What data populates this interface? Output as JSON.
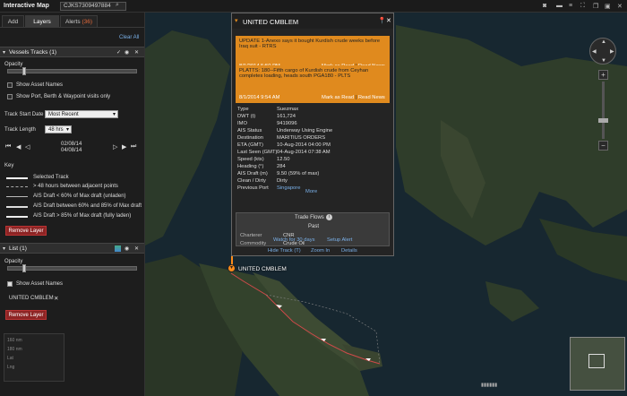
{
  "app": {
    "title": "Interactive Map",
    "search_value": "CJKS7309497884"
  },
  "tabs": [
    {
      "label": "Add"
    },
    {
      "label": "Layers"
    },
    {
      "label": "Alerts"
    }
  ],
  "alerts_count": "(36)",
  "clear_all": "Clear All",
  "vessels": {
    "title": "Vessels Tracks  (1)",
    "opacity_label": "Opacity",
    "opacity": 0.12,
    "show_asset_names": "Show Asset Names",
    "show_port": "Show Port, Berth & Waypoint visits only",
    "track_start_label": "Track Start Date",
    "track_start_value": "Most Recent",
    "track_length_label": "Track Length",
    "track_length_value": "48 hrs",
    "date1": "02/08/14",
    "date2": "04/08/14",
    "key_label": "Key",
    "key_items": [
      "Selected Track",
      "> 48 hours between adjacent points",
      "AIS Draft < 60% of Max draft (unladen)",
      "AIS Draft between 60% and 85% of Max draft",
      "AIS Draft > 85% of Max draft (fully laden)"
    ],
    "remove_label": "Remove Layer"
  },
  "list": {
    "title": "List  (1)",
    "opacity_label": "Opacity",
    "opacity": 0.12,
    "show_asset_names": "Show Asset Names",
    "asset": "UNITED CMBLEM",
    "remove_label": "Remove Layer"
  },
  "popup": {
    "title": "UNITED CMBLEM",
    "news": [
      {
        "headline": "UPDATE 1-Anexo says it bought Kurdish crude weeks before Iraq suit - RTRS",
        "date": "8/1/2014 5:50 PM",
        "mark": "Mark as Read",
        "read": "Read News"
      },
      {
        "headline": "PLATTS: 180--Fifth cargo of Kurdish crude from Ceyhan completes loading, heads south PGA180 - PLTS",
        "date": "8/1/2014 9:54 AM",
        "mark": "Mark as Read",
        "read": "Read News"
      }
    ],
    "details": [
      {
        "k": "Type",
        "v": "Suezmax"
      },
      {
        "k": "DWT (t)",
        "v": "161,724"
      },
      {
        "k": "IMO",
        "v": "9419096"
      },
      {
        "k": "AIS Status",
        "v": "Underway Using Engine"
      },
      {
        "k": "Destination",
        "v": "MARITIUS ORDERS"
      },
      {
        "k": "ETA (GMT)",
        "v": "10-Aug-2014 04:00 PM"
      },
      {
        "k": "Last Seen (GMT)",
        "v": "04-Aug-2014 07:38 AM"
      },
      {
        "k": "Speed (kts)",
        "v": "12.50"
      },
      {
        "k": "Heading (°)",
        "v": "284"
      },
      {
        "k": "AIS Draft (m)",
        "v": "9.50  (59% of max)"
      },
      {
        "k": "Clean / Dirty",
        "v": "Dirty"
      },
      {
        "k": "Previous Port",
        "v": "Singapore"
      }
    ],
    "more": "More",
    "tradeflows": {
      "title": "Trade Flows",
      "past": "Past",
      "rows": [
        {
          "k": "Charterer",
          "v": "CNR"
        },
        {
          "k": "Commodity",
          "v": "Crude Oil"
        }
      ]
    },
    "watch": "Watch for 30 days",
    "setup_alert": "Setup Alert",
    "hide_track": "Hide Track (T)",
    "zoom_in": "Zoom In",
    "details_link": "Details"
  },
  "map_label": "UNITED CMBLEM",
  "bottom_stats": [
    "160 nm",
    "180 nm",
    "Lat",
    "Lng"
  ],
  "colors": {
    "accent": "#e08a1e",
    "track": "#ff8c1a",
    "link": "#7ab0e8",
    "remove": "#8d2424"
  }
}
